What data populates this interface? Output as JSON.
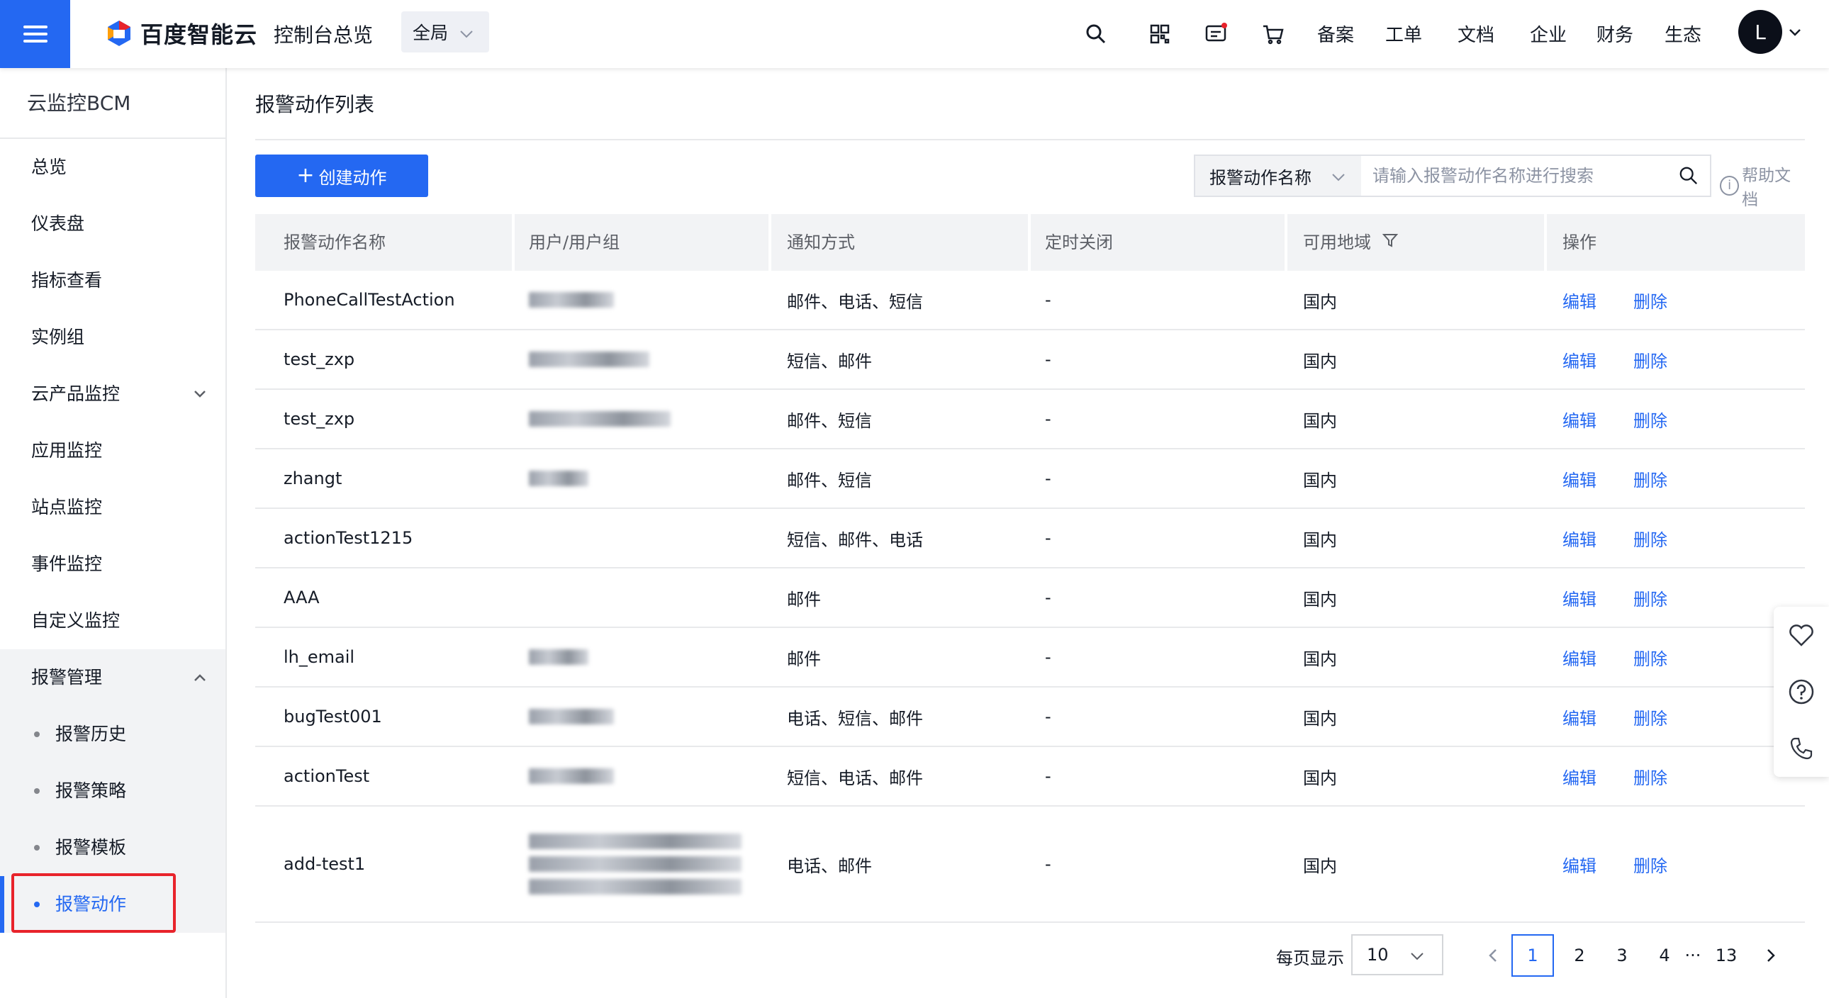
{
  "header": {
    "brand": "百度智能云",
    "console_link": "控制台总览",
    "region": "全局",
    "nav_links": [
      "备案",
      "工单",
      "文档",
      "企业",
      "财务",
      "生态"
    ],
    "avatar_letter": "L"
  },
  "sidebar": {
    "title": "云监控BCM",
    "items": [
      {
        "label": "总览"
      },
      {
        "label": "仪表盘"
      },
      {
        "label": "指标查看"
      },
      {
        "label": "实例组"
      },
      {
        "label": "云产品监控"
      },
      {
        "label": "应用监控"
      },
      {
        "label": "站点监控"
      },
      {
        "label": "事件监控"
      },
      {
        "label": "自定义监控"
      }
    ],
    "group": {
      "label": "报警管理",
      "children": [
        "报警历史",
        "报警策略",
        "报警模板",
        "报警动作"
      ],
      "active_index": 3
    }
  },
  "main": {
    "page_title": "报警动作列表",
    "create_button": "创建动作",
    "search": {
      "field": "报警动作名称",
      "placeholder": "请输入报警动作名称进行搜索"
    },
    "help_link": "帮助文档",
    "table": {
      "columns": [
        "报警动作名称",
        "用户/用户组",
        "通知方式",
        "定时关闭",
        "可用地域",
        "操作"
      ],
      "rows": [
        {
          "name": "PhoneCallTestAction",
          "notify": "邮件、电话、短信",
          "timer": "-",
          "region": "国内"
        },
        {
          "name": "test_zxp",
          "notify": "短信、邮件",
          "timer": "-",
          "region": "国内"
        },
        {
          "name": "test_zxp",
          "notify": "邮件、短信",
          "timer": "-",
          "region": "国内"
        },
        {
          "name": "zhangt",
          "notify": "邮件、短信",
          "timer": "-",
          "region": "国内"
        },
        {
          "name": "actionTest1215",
          "notify": "短信、邮件、电话",
          "timer": "-",
          "region": "国内"
        },
        {
          "name": "AAA",
          "notify": "邮件",
          "timer": "-",
          "region": "国内"
        },
        {
          "name": "lh_email",
          "notify": "邮件",
          "timer": "-",
          "region": "国内"
        },
        {
          "name": "bugTest001",
          "notify": "电话、短信、邮件",
          "timer": "-",
          "region": "国内"
        },
        {
          "name": "actionTest",
          "notify": "短信、电话、邮件",
          "timer": "-",
          "region": "国内"
        },
        {
          "name": "add-test1",
          "notify": "电话、邮件",
          "timer": "-",
          "region": "国内"
        }
      ],
      "op_edit": "编辑",
      "op_delete": "删除"
    },
    "pagination": {
      "per_page_label": "每页显示",
      "per_page": "10",
      "pages": [
        "1",
        "2",
        "3",
        "4"
      ],
      "ellipsis": "···",
      "last_page": "13",
      "current": "1"
    }
  },
  "colors": {
    "accent": "#2468f2",
    "highlight_box": "#e8232b"
  },
  "icons": [
    "menu-icon",
    "search-icon",
    "qrcode-icon",
    "message-icon",
    "cart-icon",
    "chevron-down-icon",
    "filter-icon",
    "info-icon",
    "heart-icon",
    "question-icon",
    "phone-icon"
  ]
}
